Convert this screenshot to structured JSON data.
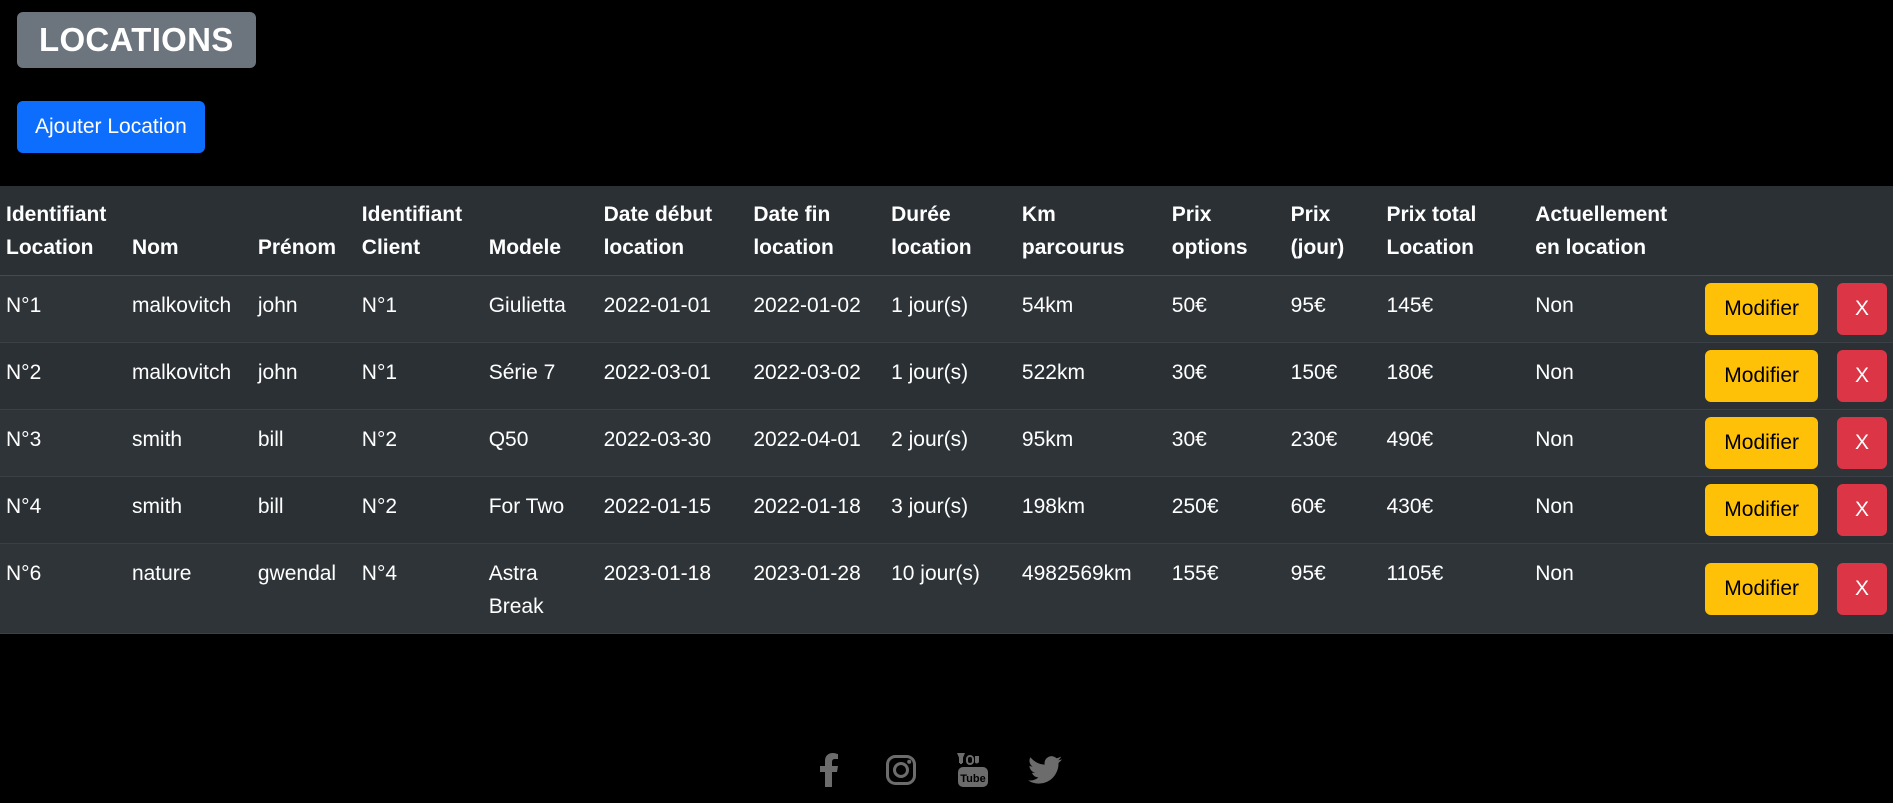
{
  "header": {
    "title": "LOCATIONS",
    "add_button_label": "Ajouter Location"
  },
  "table": {
    "headers": [
      "Identifiant Location",
      "Nom",
      "Prénom",
      "Identifiant Client",
      "Modele",
      "Date début location",
      "Date fin location",
      "Durée location",
      "Km parcourus",
      "Prix options",
      "Prix (jour)",
      "Prix total Location",
      "Actuellement en location"
    ],
    "rows": [
      {
        "id": "N°1",
        "nom": "malkovitch",
        "prenom": "john",
        "client": "N°1",
        "modele": "Giulietta",
        "debut": "2022-01-01",
        "fin": "2022-01-02",
        "duree": "1 jour(s)",
        "km": "54km",
        "options": "50€",
        "jour": "95€",
        "total": "145€",
        "actuel": "Non"
      },
      {
        "id": "N°2",
        "nom": "malkovitch",
        "prenom": "john",
        "client": "N°1",
        "modele": "Série 7",
        "debut": "2022-03-01",
        "fin": "2022-03-02",
        "duree": "1 jour(s)",
        "km": "522km",
        "options": "30€",
        "jour": "150€",
        "total": "180€",
        "actuel": "Non"
      },
      {
        "id": "N°3",
        "nom": "smith",
        "prenom": "bill",
        "client": "N°2",
        "modele": "Q50",
        "debut": "2022-03-30",
        "fin": "2022-04-01",
        "duree": "2 jour(s)",
        "km": "95km",
        "options": "30€",
        "jour": "230€",
        "total": "490€",
        "actuel": "Non"
      },
      {
        "id": "N°4",
        "nom": "smith",
        "prenom": "bill",
        "client": "N°2",
        "modele": "For Two",
        "debut": "2022-01-15",
        "fin": "2022-01-18",
        "duree": "3 jour(s)",
        "km": "198km",
        "options": "250€",
        "jour": "60€",
        "total": "430€",
        "actuel": "Non"
      },
      {
        "id": "N°6",
        "nom": "nature",
        "prenom": "gwendal",
        "client": "N°4",
        "modele": "Astra Break",
        "debut": "2023-01-18",
        "fin": "2023-01-28",
        "duree": "10 jour(s)",
        "km": "4982569km",
        "options": "155€",
        "jour": "95€",
        "total": "1105€",
        "actuel": "Non"
      }
    ],
    "edit_label": "Modifier",
    "delete_label": "X"
  },
  "footer": {
    "icons": [
      "facebook-icon",
      "instagram-icon",
      "youtube-icon",
      "twitter-icon"
    ]
  },
  "colors": {
    "background": "#000000",
    "title_badge": "#6c757d",
    "primary": "#0d6efd",
    "warning": "#ffc107",
    "danger": "#dc3545",
    "table_bg": "#2b3035",
    "footer_icon": "#6c6c6c"
  }
}
